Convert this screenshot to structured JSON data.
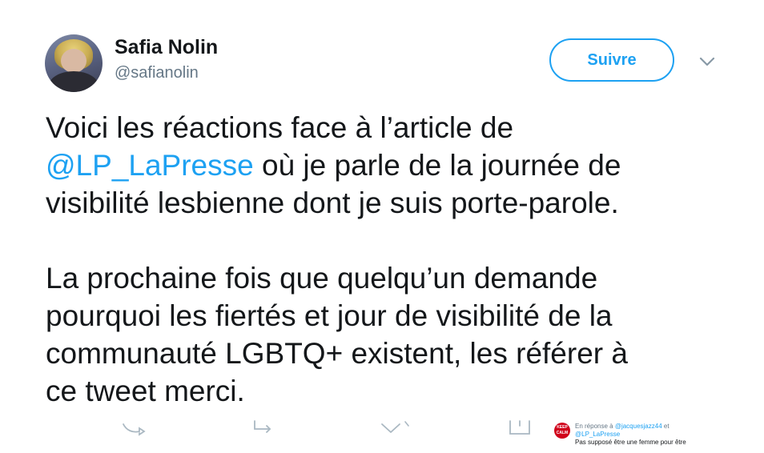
{
  "tweet": {
    "author": {
      "name": "Safia Nolin",
      "handle": "@safianolin"
    },
    "follow_label": "Suivre",
    "lines": {
      "l1": "Voici les réactions face à l’article de",
      "l2_mention": "@LP_LaPresse",
      "l2_rest": " où je parle de la journée de",
      "l3": "visibilité lesbienne dont je suis porte-parole.",
      "l4": "La prochaine fois que quelqu’un demande",
      "l5": "pourquoi les fiertés et jour de visibilité de la",
      "l6": "communauté LGBTQ+ existent, les référer à",
      "l7": "ce tweet merci."
    }
  },
  "embedded_preview": {
    "avatar_text": "KEEP CALM",
    "reply_prefix": "En réponse à",
    "reply_to_1": "@jacquesjazz44",
    "reply_joiner": "et",
    "reply_to_2": "@LP_LaPresse",
    "body_cut": "Pas supposé être une femme pour être"
  },
  "colors": {
    "accent": "#1da1f2",
    "text": "#14171a",
    "secondary": "#657786"
  },
  "icons": {
    "more": "chevron-down-icon",
    "reply": "reply-icon",
    "retweet": "retweet-icon",
    "like": "heart-icon",
    "message": "message-icon"
  }
}
